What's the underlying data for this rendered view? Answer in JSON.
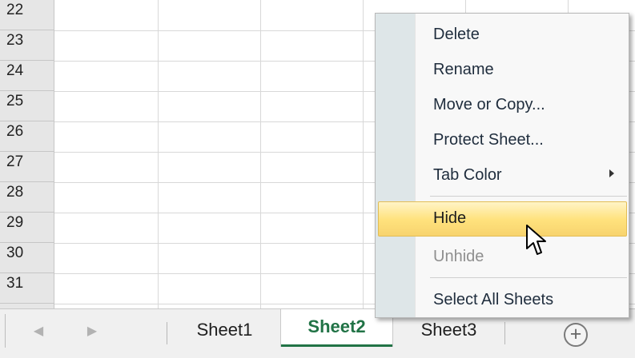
{
  "spreadsheet": {
    "row_numbers": [
      "22",
      "23",
      "24",
      "25",
      "26",
      "27",
      "28",
      "29",
      "30",
      "31"
    ]
  },
  "sheet_tabs": {
    "navigation": {
      "previous_icon": "chevron-left-icon",
      "next_icon": "chevron-right-icon",
      "previous_glyph": "◀",
      "next_glyph": "▶"
    },
    "tabs": [
      {
        "label": "Sheet1",
        "active": false
      },
      {
        "label": "Sheet2",
        "active": true
      },
      {
        "label": "Sheet3",
        "active": false
      }
    ],
    "new_sheet": {
      "icon": "plus-circle-icon",
      "glyph": "+"
    },
    "active_tab_color": "#217346"
  },
  "context_menu": {
    "items": [
      {
        "label": "Delete",
        "enabled": true
      },
      {
        "label": "Rename",
        "enabled": true
      },
      {
        "label": "Move or Copy...",
        "enabled": true
      },
      {
        "label": "Protect Sheet...",
        "enabled": true
      },
      {
        "label": "Tab Color",
        "enabled": true,
        "submenu_icon": "chevron-right-icon"
      },
      {
        "label": "Hide",
        "enabled": true,
        "highlighted": true
      },
      {
        "label": "Unhide",
        "enabled": false
      },
      {
        "label": "Select All Sheets",
        "enabled": true
      }
    ],
    "highlight_color": "#ffe27d"
  },
  "pointer": {
    "icon": "mouse-pointer-icon"
  }
}
